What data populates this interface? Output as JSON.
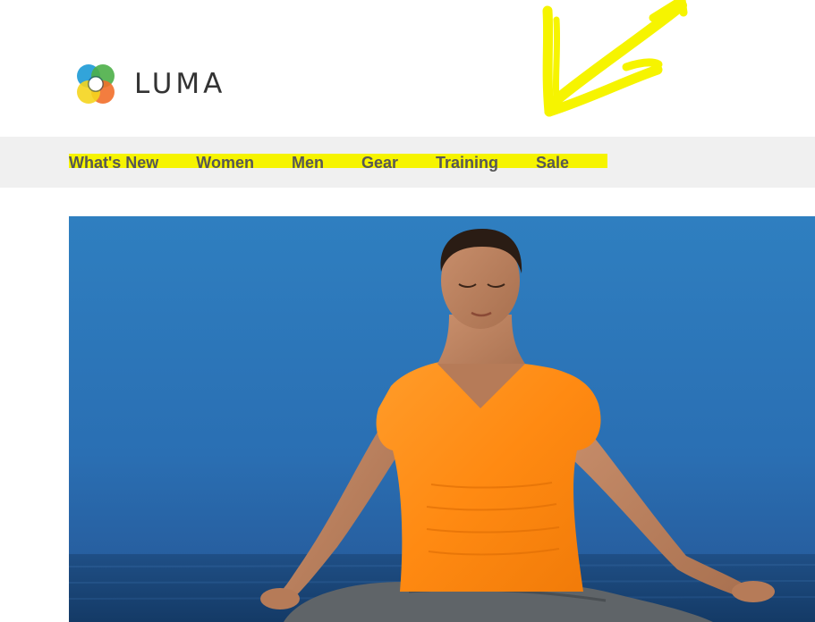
{
  "brand": {
    "name": "LUMA"
  },
  "nav": {
    "items": [
      {
        "label": "What's New"
      },
      {
        "label": "Women"
      },
      {
        "label": "Men"
      },
      {
        "label": "Gear"
      },
      {
        "label": "Training"
      },
      {
        "label": "Sale"
      }
    ]
  },
  "colors": {
    "annotation_yellow": "#f6f400",
    "nav_background": "#f0f0f0",
    "nav_text": "#575757",
    "brand_text": "#333333"
  },
  "hero": {
    "image": "woman-meditating-by-sea"
  }
}
